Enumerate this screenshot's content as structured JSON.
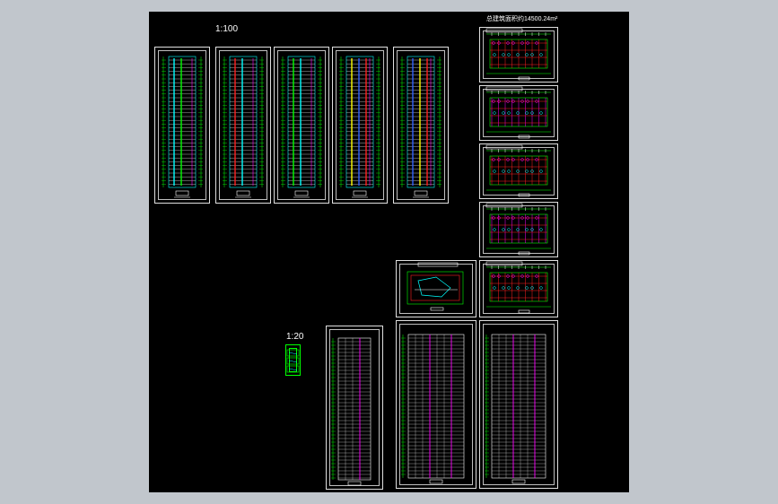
{
  "drawing": {
    "scale_main": "1:100",
    "scale_detail": "1:20",
    "area_note": "总建筑面积约14500.24m²"
  },
  "colors": {
    "background": "#c1c6cc",
    "canvas": "#000000",
    "frame": "#e0e0e0",
    "green": "#00ff00",
    "magenta": "#ff00ff",
    "red": "#ff2020",
    "yellow": "#ffff00",
    "blue": "#3060ff",
    "cyan": "#00ffff",
    "white": "#ffffff"
  }
}
